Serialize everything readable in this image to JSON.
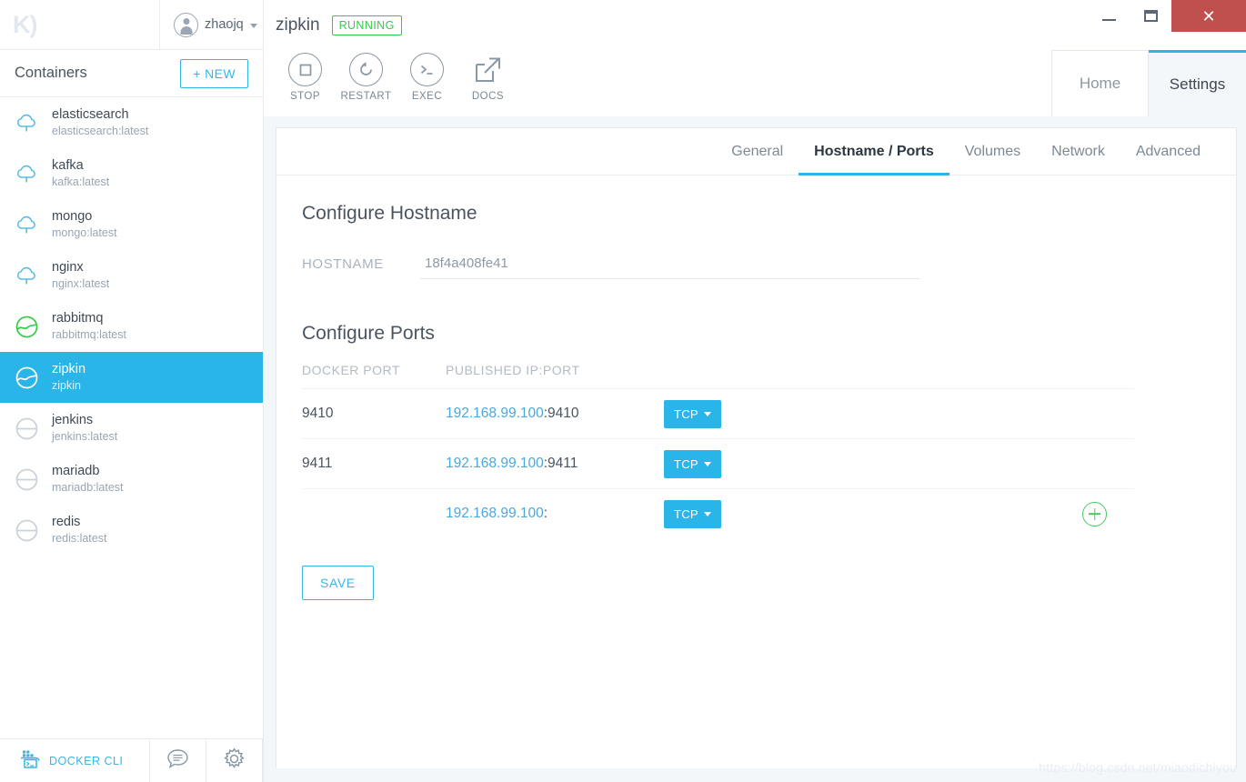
{
  "sidebar": {
    "logo": "K)",
    "user": {
      "name": "zhaojq",
      "avatar_icon": "user-avatar-icon",
      "caret_icon": "chevron-down-icon"
    },
    "header": {
      "title": "Containers",
      "new_button": "+ NEW"
    },
    "containers": [
      {
        "name": "elasticsearch",
        "image": "elasticsearch:latest",
        "state": "download",
        "icon": "cloud-download-icon"
      },
      {
        "name": "kafka",
        "image": "kafka:latest",
        "state": "download",
        "icon": "cloud-download-icon"
      },
      {
        "name": "mongo",
        "image": "mongo:latest",
        "state": "download",
        "icon": "cloud-download-icon"
      },
      {
        "name": "nginx",
        "image": "nginx:latest",
        "state": "download",
        "icon": "cloud-download-icon"
      },
      {
        "name": "rabbitmq",
        "image": "rabbitmq:latest",
        "state": "running",
        "icon": "container-running-icon"
      },
      {
        "name": "zipkin",
        "image": "zipkin",
        "state": "selected",
        "icon": "container-running-icon"
      },
      {
        "name": "jenkins",
        "image": "jenkins:latest",
        "state": "stopped",
        "icon": "container-stopped-icon"
      },
      {
        "name": "mariadb",
        "image": "mariadb:latest",
        "state": "stopped",
        "icon": "container-stopped-icon"
      },
      {
        "name": "redis",
        "image": "redis:latest",
        "state": "stopped",
        "icon": "container-stopped-icon"
      }
    ],
    "footer": {
      "cli_label": "DOCKER CLI",
      "cli_icon": "docker-terminal-icon",
      "feedback_icon": "chat-bubble-icon",
      "settings_icon": "gear-icon"
    }
  },
  "titlebar": {
    "container_name": "zipkin",
    "status_badge": "RUNNING",
    "minimize_icon": "minimize-icon",
    "maximize_icon": "maximize-icon",
    "close_icon": "close-icon"
  },
  "toolbar": [
    {
      "label": "STOP",
      "icon": "stop-square-icon"
    },
    {
      "label": "RESTART",
      "icon": "restart-arrow-icon"
    },
    {
      "label": "EXEC",
      "icon": "terminal-prompt-icon"
    },
    {
      "label": "DOCS",
      "icon": "external-link-icon"
    }
  ],
  "top_tabs": [
    {
      "label": "Home",
      "active": false
    },
    {
      "label": "Settings",
      "active": true
    }
  ],
  "sub_tabs": [
    {
      "label": "General",
      "active": false
    },
    {
      "label": "Hostname / Ports",
      "active": true
    },
    {
      "label": "Volumes",
      "active": false
    },
    {
      "label": "Network",
      "active": false
    },
    {
      "label": "Advanced",
      "active": false
    }
  ],
  "hostname_section": {
    "title": "Configure Hostname",
    "label": "HOSTNAME",
    "value": "18f4a408fe41",
    "placeholder": "hostname"
  },
  "ports_section": {
    "title": "Configure Ports",
    "columns": {
      "docker_port": "DOCKER PORT",
      "published": "PUBLISHED IP:PORT"
    },
    "rows": [
      {
        "docker_port": "9410",
        "ip": "192.168.99.100",
        "port": ":9410",
        "protocol": "TCP",
        "has_add": false
      },
      {
        "docker_port": "9411",
        "ip": "192.168.99.100",
        "port": ":9411",
        "protocol": "TCP",
        "has_add": false
      },
      {
        "docker_port": "",
        "ip": "192.168.99.100",
        "port": ":",
        "protocol": "TCP",
        "has_add": true
      }
    ],
    "save_button": "SAVE",
    "add_icon": "plus-circle-icon"
  },
  "watermark": "https://blog.csdn.net/miaodichiyou",
  "colors": {
    "accent_blue": "#29b5e8",
    "link_blue": "#4aa8e0",
    "running_green": "#33cc4a",
    "add_green": "#4bc95f",
    "close_red": "#c0504d",
    "panel_bg": "#f4f7fa"
  }
}
